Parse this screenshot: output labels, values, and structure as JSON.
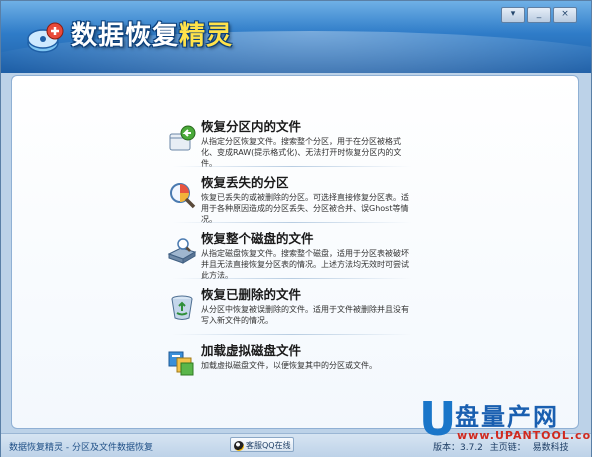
{
  "app": {
    "title_part1": "数据恢复",
    "title_part2": "精灵"
  },
  "window_controls": {
    "menu": "▾",
    "minimize": "_",
    "close": "×"
  },
  "menu": [
    {
      "title": "恢复分区内的文件",
      "desc": "从指定分区恢复文件。搜索整个分区，用于在分区被格式化、变成RAW(提示格式化)、无法打开时恢复分区内的文件。",
      "icon": "partition-file-icon"
    },
    {
      "title": "恢复丢失的分区",
      "desc": "恢复已丢失的或被删除的分区。可选择直接修复分区表。适用于各种原因造成的分区丢失、分区被合并、误Ghost等情况。",
      "icon": "magnifier-disk-icon"
    },
    {
      "title": "恢复整个磁盘的文件",
      "desc": "从指定磁盘恢复文件。搜索整个磁盘，适用于分区表被破坏并且无法直接恢复分区表的情况。上述方法均无效时可尝试此方法。",
      "icon": "hard-disk-icon"
    },
    {
      "title": "恢复已删除的文件",
      "desc": "从分区中恢复被误删除的文件。适用于文件被删除并且没有写入新文件的情况。",
      "icon": "recycle-bin-icon"
    },
    {
      "title": "加载虚拟磁盘文件",
      "desc": "加载虚拟磁盘文件，以便恢复其中的分区或文件。",
      "icon": "virtual-disk-icon"
    }
  ],
  "status": {
    "left_text": "数据恢复精灵 - 分区及文件数据恢复",
    "qq_button": "客服QQ在线",
    "version": "版本：3.7.2",
    "homepage": "主页链：",
    "company": "易数科技"
  },
  "watermark": {
    "letter": "U",
    "text": "盘量产网",
    "url": "www.UPANTOOL.com"
  },
  "colors": {
    "titlebar": "#2f7cc8",
    "title_accent": "#ffe24a",
    "watermark_blue": "#1a5fb0",
    "watermark_red": "#d02a1f"
  }
}
